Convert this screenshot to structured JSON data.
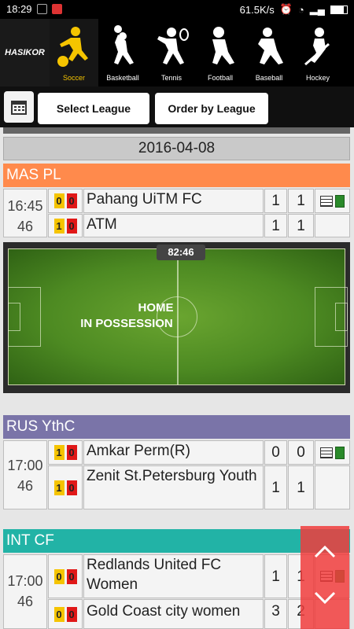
{
  "status_bar": {
    "time": "18:29",
    "network_speed": "61.5K/s"
  },
  "logo": {
    "text": "HASIKOR"
  },
  "sports": [
    {
      "label": "Soccer",
      "active": true
    },
    {
      "label": "Basketball",
      "active": false
    },
    {
      "label": "Tennis",
      "active": false
    },
    {
      "label": "Football",
      "active": false
    },
    {
      "label": "Baseball",
      "active": false
    },
    {
      "label": "Hockey",
      "active": false
    }
  ],
  "toolbar": {
    "select_league_label": "Select League",
    "order_by_label": "Order by League"
  },
  "date": "2016-04-08",
  "colors": {
    "mas_pl": "#ff8a4c",
    "rus_ythc": "#7a74a8",
    "int_cf": "#22b3a6",
    "active_sport": "#f5c400"
  },
  "leagues": [
    {
      "name": "MAS PL",
      "matches": [
        {
          "time": "16:45",
          "minute": "46",
          "home": {
            "team": "Pahang UiTM FC",
            "yellow": "0",
            "red": "0",
            "score": "1",
            "ht": "1"
          },
          "away": {
            "team": "ATM",
            "yellow": "1",
            "red": "0",
            "score": "1",
            "ht": "1"
          }
        }
      ],
      "live_pitch": {
        "clock": "82:46",
        "line1": "HOME",
        "line2": "IN POSSESSION"
      }
    },
    {
      "name": "RUS YthC",
      "matches": [
        {
          "time": "17:00",
          "minute": "46",
          "home": {
            "team": "Amkar Perm(R)",
            "yellow": "1",
            "red": "0",
            "score": "0",
            "ht": "0"
          },
          "away": {
            "team": "Zenit St.Petersburg Youth",
            "yellow": "1",
            "red": "0",
            "score": "1",
            "ht": "1"
          }
        }
      ]
    },
    {
      "name": "INT CF",
      "matches": [
        {
          "time": "17:00",
          "minute": "46",
          "home": {
            "team": "Redlands United FC Women",
            "yellow": "0",
            "red": "0",
            "score": "1",
            "ht": "1"
          },
          "away": {
            "team": "Gold Coast city women",
            "yellow": "0",
            "red": "0",
            "score": "3",
            "ht": "2"
          }
        }
      ]
    }
  ]
}
